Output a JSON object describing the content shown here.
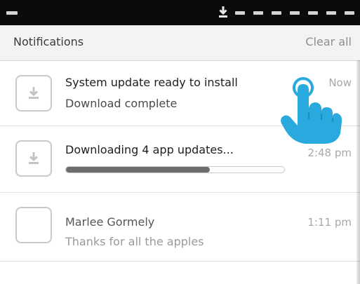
{
  "status_bar": {
    "icons": [
      "download-icon",
      "status-icons"
    ]
  },
  "header": {
    "title": "Notifications",
    "clear_all": "Clear all"
  },
  "notifications": [
    {
      "icon": "download-icon",
      "title": "System update ready to install",
      "subtitle": "Download complete",
      "time": "Now"
    },
    {
      "icon": "download-icon",
      "title": "Downloading 4 app updates...",
      "time": "2:48 pm",
      "progress": 0.66
    },
    {
      "icon": "app-icon",
      "title": "Marlee Gormely",
      "subtitle": "Thanks for all the apples",
      "time": "1:11 pm"
    }
  ],
  "overlay": {
    "icon": "tap-hand-icon",
    "color": "#29a9de"
  }
}
